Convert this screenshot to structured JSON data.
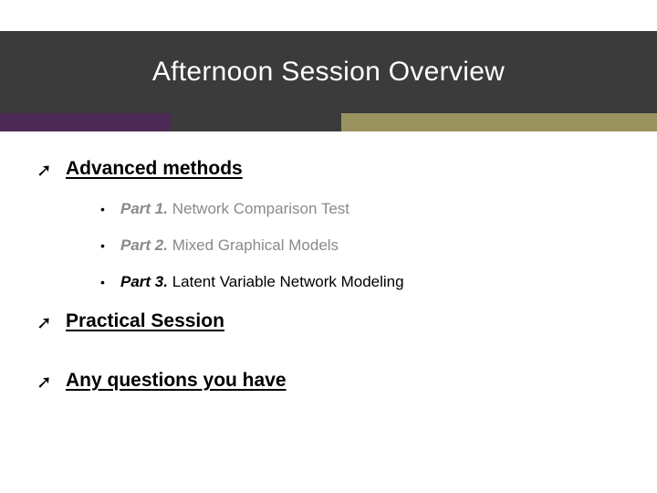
{
  "slide": {
    "title": "Afternoon Session Overview",
    "sections": [
      {
        "label": "Advanced methods"
      },
      {
        "label": "Practical Session"
      },
      {
        "label": "Any questions you have"
      }
    ],
    "parts": [
      {
        "lead": "Part 1.",
        "rest": " Network Comparison Test",
        "muted": true
      },
      {
        "lead": "Part 2.",
        "rest": " Mixed Graphical Models",
        "muted": true
      },
      {
        "lead": "Part 3.",
        "rest": " Latent Variable Network Modeling",
        "muted": false
      }
    ],
    "colors": {
      "title_band": "#3b3b3b",
      "accent_purple": "#4b2a55",
      "accent_dark": "#3b3b3b",
      "accent_olive": "#9a9360"
    }
  }
}
